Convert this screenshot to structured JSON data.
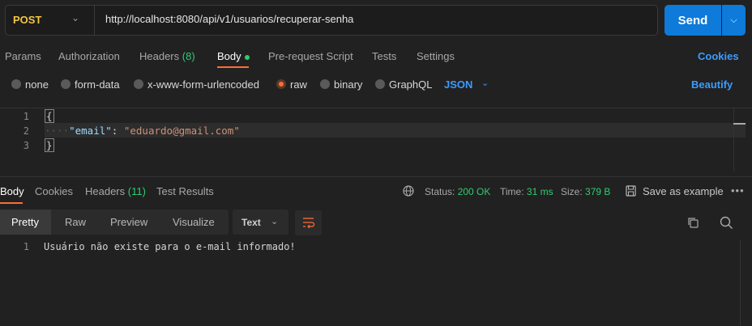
{
  "request": {
    "method": "POST",
    "url": "http://localhost:8080/api/v1/usuarios/recuperar-senha",
    "send_label": "Send"
  },
  "request_tabs": [
    {
      "label": "Params"
    },
    {
      "label": "Authorization"
    },
    {
      "label": "Headers",
      "count": "(8)"
    },
    {
      "label": "Body"
    },
    {
      "label": "Pre-request Script"
    },
    {
      "label": "Tests"
    },
    {
      "label": "Settings"
    }
  ],
  "cookies_label": "Cookies",
  "body_options": [
    {
      "label": "none"
    },
    {
      "label": "form-data"
    },
    {
      "label": "x-www-form-urlencoded"
    },
    {
      "label": "raw"
    },
    {
      "label": "binary"
    },
    {
      "label": "GraphQL"
    }
  ],
  "body_format": "JSON",
  "beautify_label": "Beautify",
  "editor": {
    "line_numbers": [
      "1",
      "2",
      "3"
    ],
    "open_brace": "{",
    "close_brace": "}",
    "key": "\"email\"",
    "colon": ": ",
    "value": "\"eduardo@gmail.com\""
  },
  "response_tabs": [
    {
      "label": "Body"
    },
    {
      "label": "Cookies"
    },
    {
      "label": "Headers",
      "count": "(11)"
    },
    {
      "label": "Test Results"
    }
  ],
  "status": {
    "status_label": "Status:",
    "status_value": "200 OK",
    "time_label": "Time:",
    "time_value": "31 ms",
    "size_label": "Size:",
    "size_value": "379 B"
  },
  "save_example_label": "Save as example",
  "view_modes": [
    {
      "label": "Pretty"
    },
    {
      "label": "Raw"
    },
    {
      "label": "Preview"
    },
    {
      "label": "Visualize"
    }
  ],
  "response_format": "Text",
  "response": {
    "line_number": "1",
    "text": "Usuário não existe para o e-mail informado!"
  },
  "colors": {
    "accent": "#ff6c37",
    "link": "#3b9cff",
    "send": "#0e7ad9",
    "method": "#f2c744",
    "success": "#2ecc71"
  }
}
